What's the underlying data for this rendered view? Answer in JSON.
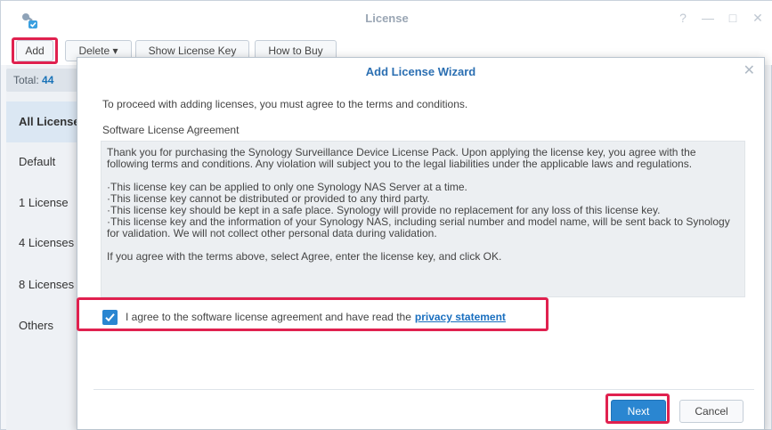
{
  "window": {
    "title": "License",
    "controls": [
      "?",
      "—",
      "□",
      "✕"
    ]
  },
  "toolbar": {
    "add_label": "Add",
    "delete_label": "Delete ▾",
    "show_key_label": "Show License Key",
    "how_to_buy_label": "How to Buy"
  },
  "sidebar": {
    "total_label": "Total:",
    "total_value": "44",
    "items": [
      {
        "label": "All Licenses"
      },
      {
        "label": "Default"
      },
      {
        "label": "1 License"
      },
      {
        "label": "4 Licenses"
      },
      {
        "label": "8 Licenses"
      },
      {
        "label": "Others"
      }
    ]
  },
  "dialog": {
    "title": "Add License Wizard",
    "intro": "To proceed with adding licenses, you must agree to the terms and conditions.",
    "sla_label": "Software License Agreement",
    "agreement_para1": "Thank you for purchasing the Synology Surveillance Device License Pack. Upon applying the license key, you agree with the following terms and conditions. Any violation will subject you to the legal liabilities under the applicable laws and regulations.",
    "bullets": [
      "·This license key can be applied to only one Synology NAS Server at a time.",
      "·This license key cannot be distributed or provided to any third party.",
      "·This license key should be kept in a safe place. Synology will provide no replacement for any loss of this license key.",
      "·This license key and the information of your Synology NAS, including serial number and model name, will be sent back to Synology for validation. We will not collect other personal data during validation."
    ],
    "agreement_para3": "If you agree with the terms above, select Agree, enter the license key, and click OK.",
    "agree_text": "I agree to the software license agreement and have read the",
    "privacy_link": "privacy statement",
    "agree_checked": true,
    "next_label": "Next",
    "cancel_label": "Cancel"
  },
  "colors": {
    "accent": "#2a86d1",
    "highlight": "#e0214f",
    "title_blue": "#2b6fb2"
  }
}
